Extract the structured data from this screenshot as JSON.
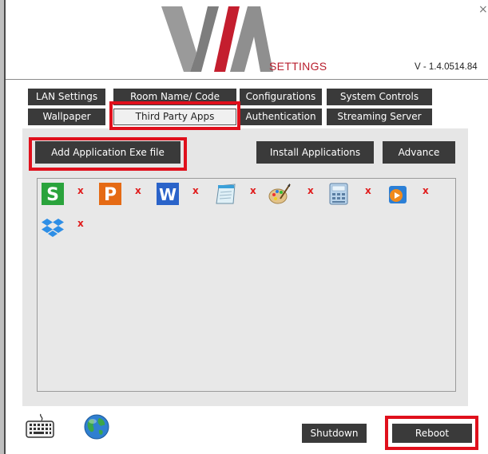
{
  "window": {
    "logo_text": "VIA",
    "settings_label": "SETTINGS",
    "version": "V - 1.4.0514.84",
    "close_glyph": "×"
  },
  "tabs": {
    "row1": [
      "LAN Settings",
      "Room Name/ Code",
      "Configurations",
      "System Controls"
    ],
    "row2": [
      "Wallpaper",
      "Third Party Apps",
      "Authentication",
      "Streaming Server"
    ],
    "active": "Third Party Apps"
  },
  "actions": {
    "add_exe": "Add Application Exe file",
    "install": "Install Applications",
    "advance": "Advance"
  },
  "apps": [
    {
      "name": "s-app-icon",
      "letter": "S",
      "color": "#2aa33c",
      "remove": "x"
    },
    {
      "name": "p-app-icon",
      "letter": "P",
      "color": "#e56a14",
      "remove": "x"
    },
    {
      "name": "w-app-icon",
      "letter": "W",
      "color": "#2a63c9",
      "remove": "x"
    },
    {
      "name": "notepad-icon",
      "letter": "",
      "color": "#cfe6f2",
      "remove": "x"
    },
    {
      "name": "paint-icon",
      "letter": "",
      "color": "#d9b06a",
      "remove": "x"
    },
    {
      "name": "calculator-icon",
      "letter": "",
      "color": "#7fb0d9",
      "remove": "x"
    },
    {
      "name": "media-player-icon",
      "letter": "",
      "color": "#2b7fd6",
      "remove": "x"
    },
    {
      "name": "dropbox-icon",
      "letter": "",
      "color": "#2d8ee6",
      "remove": "x"
    }
  ],
  "bottom": {
    "keyboard_icon": "keyboard-icon",
    "globe_icon": "globe-icon",
    "shutdown": "Shutdown",
    "reboot": "Reboot"
  },
  "colors": {
    "accent_red": "#e0101c",
    "button_dark": "#3a3a3a",
    "brand_red": "#b81e2d"
  }
}
